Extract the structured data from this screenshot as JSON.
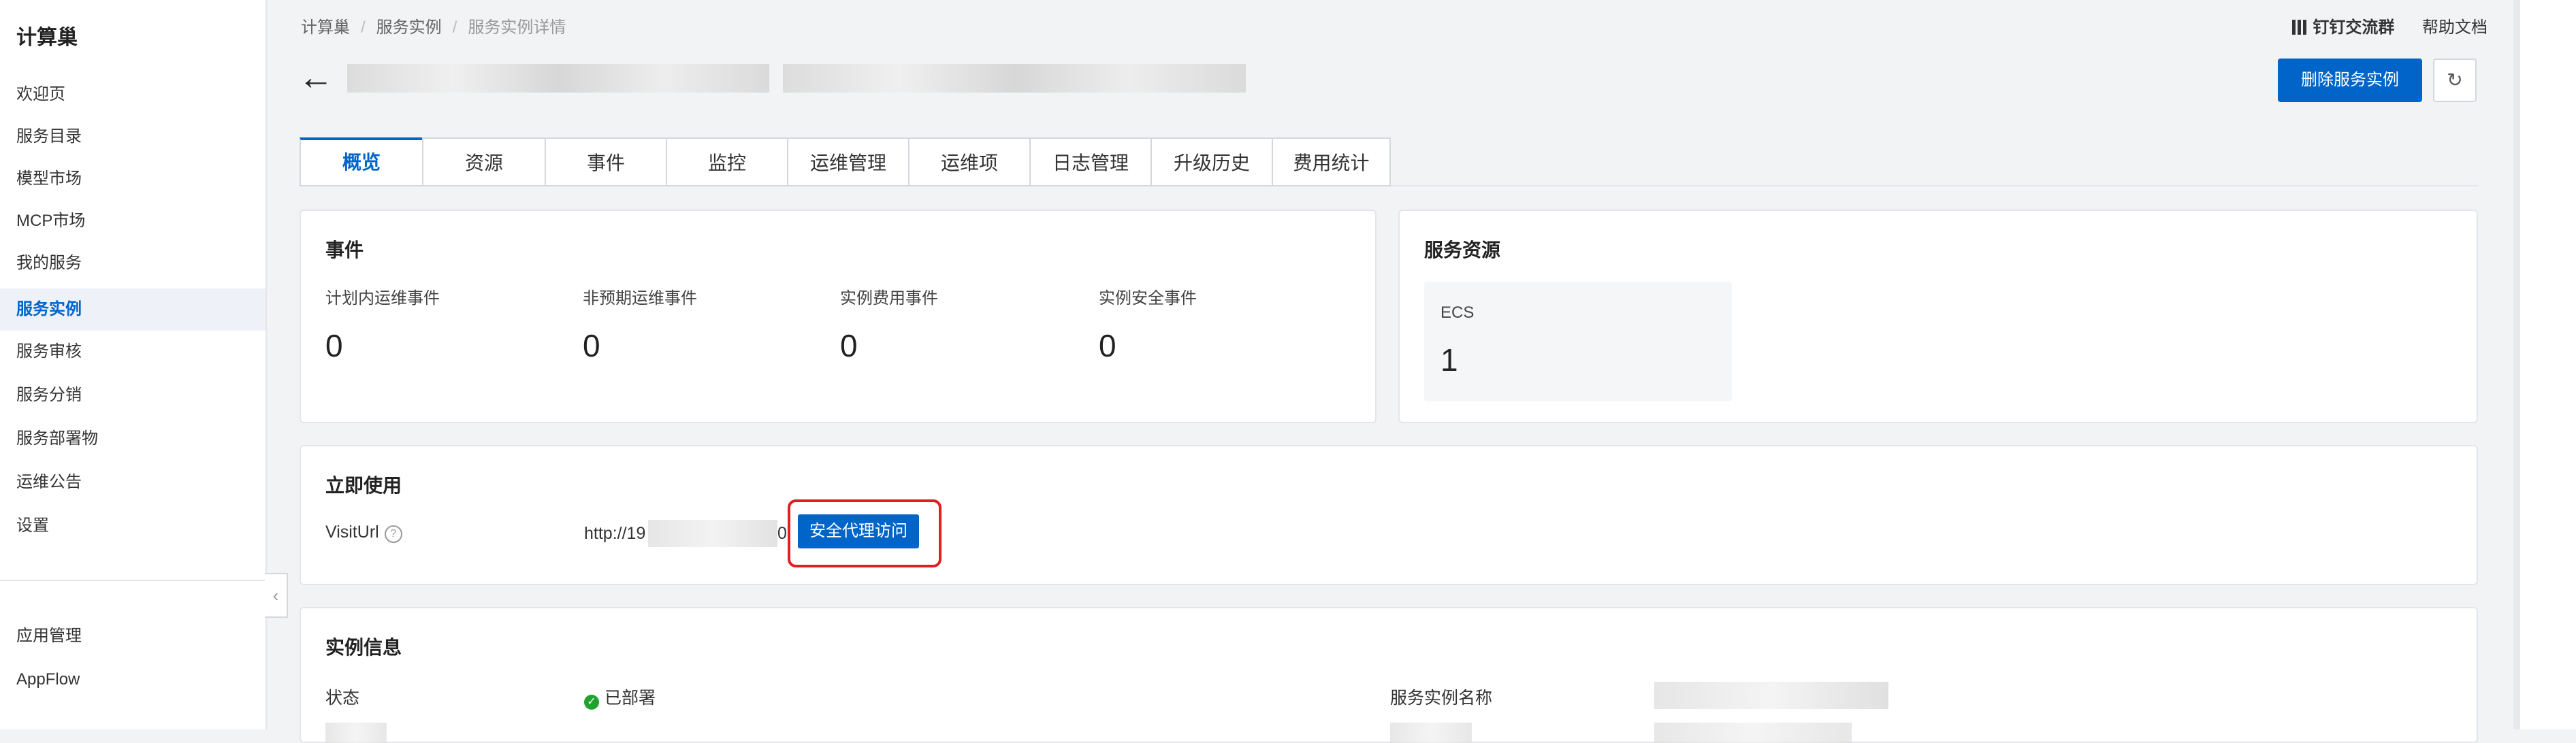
{
  "sidebar": {
    "brand": "计算巢",
    "items": [
      {
        "label": "欢迎页"
      },
      {
        "label": "服务目录"
      },
      {
        "label": "模型市场"
      },
      {
        "label": "MCP市场"
      },
      {
        "label": "我的服务"
      },
      {
        "label": "服务实例",
        "active": true
      },
      {
        "label": "服务审核"
      },
      {
        "label": "服务分销"
      },
      {
        "label": "服务部署物"
      },
      {
        "label": "运维公告"
      },
      {
        "label": "设置"
      }
    ],
    "bottom_items": [
      {
        "label": "应用管理"
      },
      {
        "label": "AppFlow"
      }
    ],
    "collapse_icon": "‹"
  },
  "breadcrumb": [
    "计算巢",
    "服务实例",
    "服务实例详情"
  ],
  "top_links": {
    "dingtalk": "钉钉交流群",
    "help": "帮助文档"
  },
  "header": {
    "back_icon": "←",
    "delete_button": "删除服务实例",
    "refresh_icon": "↻"
  },
  "tabs": [
    {
      "label": "概览",
      "active": true
    },
    {
      "label": "资源"
    },
    {
      "label": "事件"
    },
    {
      "label": "监控"
    },
    {
      "label": "运维管理"
    },
    {
      "label": "运维项"
    },
    {
      "label": "日志管理"
    },
    {
      "label": "升级历史"
    },
    {
      "label": "费用统计"
    }
  ],
  "events": {
    "title": "事件",
    "stats": [
      {
        "label": "计划内运维事件",
        "value": "0"
      },
      {
        "label": "非预期运维事件",
        "value": "0"
      },
      {
        "label": "实例费用事件",
        "value": "0"
      },
      {
        "label": "实例安全事件",
        "value": "0"
      }
    ]
  },
  "resources": {
    "title": "服务资源",
    "items": [
      {
        "label": "ECS",
        "value": "1"
      }
    ]
  },
  "use_now": {
    "title": "立即使用",
    "visit_label": "VisitUrl",
    "help_icon": "?",
    "url_prefix": "http://19",
    "url_suffix": "0",
    "proxy_button": "安全代理访问"
  },
  "instance_info": {
    "title": "实例信息",
    "status_label": "状态",
    "status_value": "已部署",
    "status_icon": "✓",
    "name_label": "服务实例名称"
  },
  "colors": {
    "accent": "#0064c8",
    "highlight": "#e02020",
    "success": "#1fa32e"
  }
}
